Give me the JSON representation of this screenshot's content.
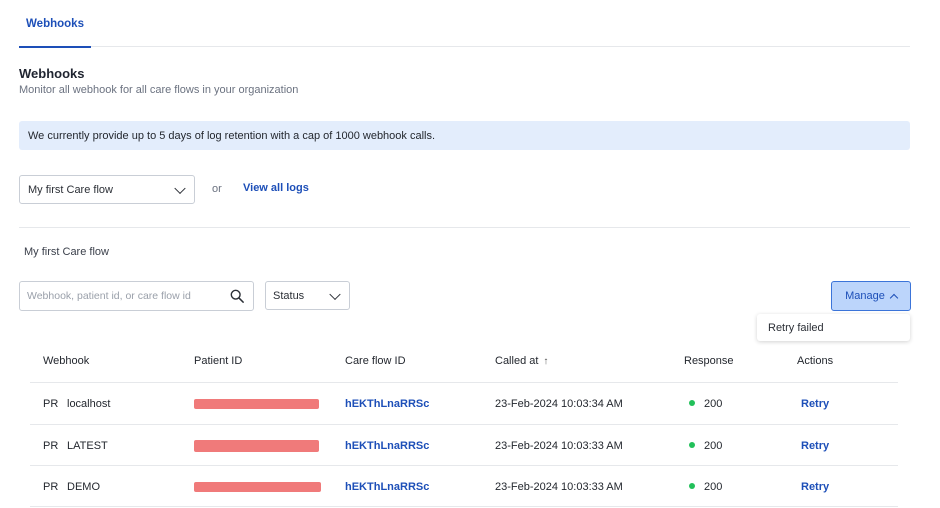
{
  "tabs": [
    {
      "label": "Webhooks"
    }
  ],
  "header": {
    "title": "Webhooks",
    "subtitle": "Monitor all webhook for all care flows in your organization"
  },
  "banner": {
    "text": "We currently provide up to 5 days of log retention with a cap of 1000 webhook calls."
  },
  "filter": {
    "care_flow_value": "My first Care flow",
    "or_text": "or",
    "view_all_label": "View all logs"
  },
  "section": {
    "title": "My first Care flow"
  },
  "toolbar": {
    "search_placeholder": "Webhook, patient id, or care flow id",
    "status_value": "Status",
    "manage_label": "Manage"
  },
  "manage_menu": {
    "items": [
      {
        "label": "Retry failed"
      }
    ]
  },
  "table": {
    "columns": [
      "Webhook",
      "Patient ID",
      "Care flow ID",
      "Called at",
      "Response",
      "Actions"
    ],
    "rows": [
      {
        "prefix": "PR",
        "webhook": "localhost",
        "care_flow_id": "hEKThLnaRRSc",
        "called_at": "23-Feb-2024 10:03:34 AM",
        "response": "200",
        "action": "Retry"
      },
      {
        "prefix": "PR",
        "webhook": "LATEST",
        "care_flow_id": "hEKThLnaRRSc",
        "called_at": "23-Feb-2024 10:03:33 AM",
        "response": "200",
        "action": "Retry"
      },
      {
        "prefix": "PR",
        "webhook": "DEMO",
        "care_flow_id": "hEKThLnaRRSc",
        "called_at": "23-Feb-2024 10:03:33 AM",
        "response": "200",
        "action": "Retry"
      }
    ]
  },
  "icons": {
    "search": "search-icon",
    "dropdown": "chevron-down-icon",
    "manage": "chevron-up-icon",
    "sort": "arrow-up-icon",
    "status": "status-dot-icon"
  },
  "colors": {
    "accent": "#1d4fb8",
    "banner_bg": "#e3edfc",
    "manage_bg": "#bcd5fb",
    "success": "#22c05a",
    "redaction": "#f07a7a"
  }
}
